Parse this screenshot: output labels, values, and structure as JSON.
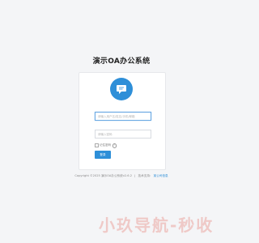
{
  "header": {
    "title": "演示OA办公系统"
  },
  "login": {
    "username_placeholder": "请输入用户名/姓名/手机/邮箱",
    "password_placeholder": "请输入密码",
    "remember_label": "记住密码",
    "submit_label": "登录"
  },
  "footer": {
    "copyright": "Copyright ©2025 演示OA办公系统v2.6.2",
    "separator": "|",
    "support_label": "技术支持：",
    "support_link": "某公司信息"
  },
  "watermark": {
    "text": "小玖导航-秒收"
  },
  "colors": {
    "accent": "#2e8fd8",
    "background": "#f4f5f7"
  },
  "icons": {
    "logo": "chat-bubble-icon",
    "help": "question-circle-icon"
  }
}
